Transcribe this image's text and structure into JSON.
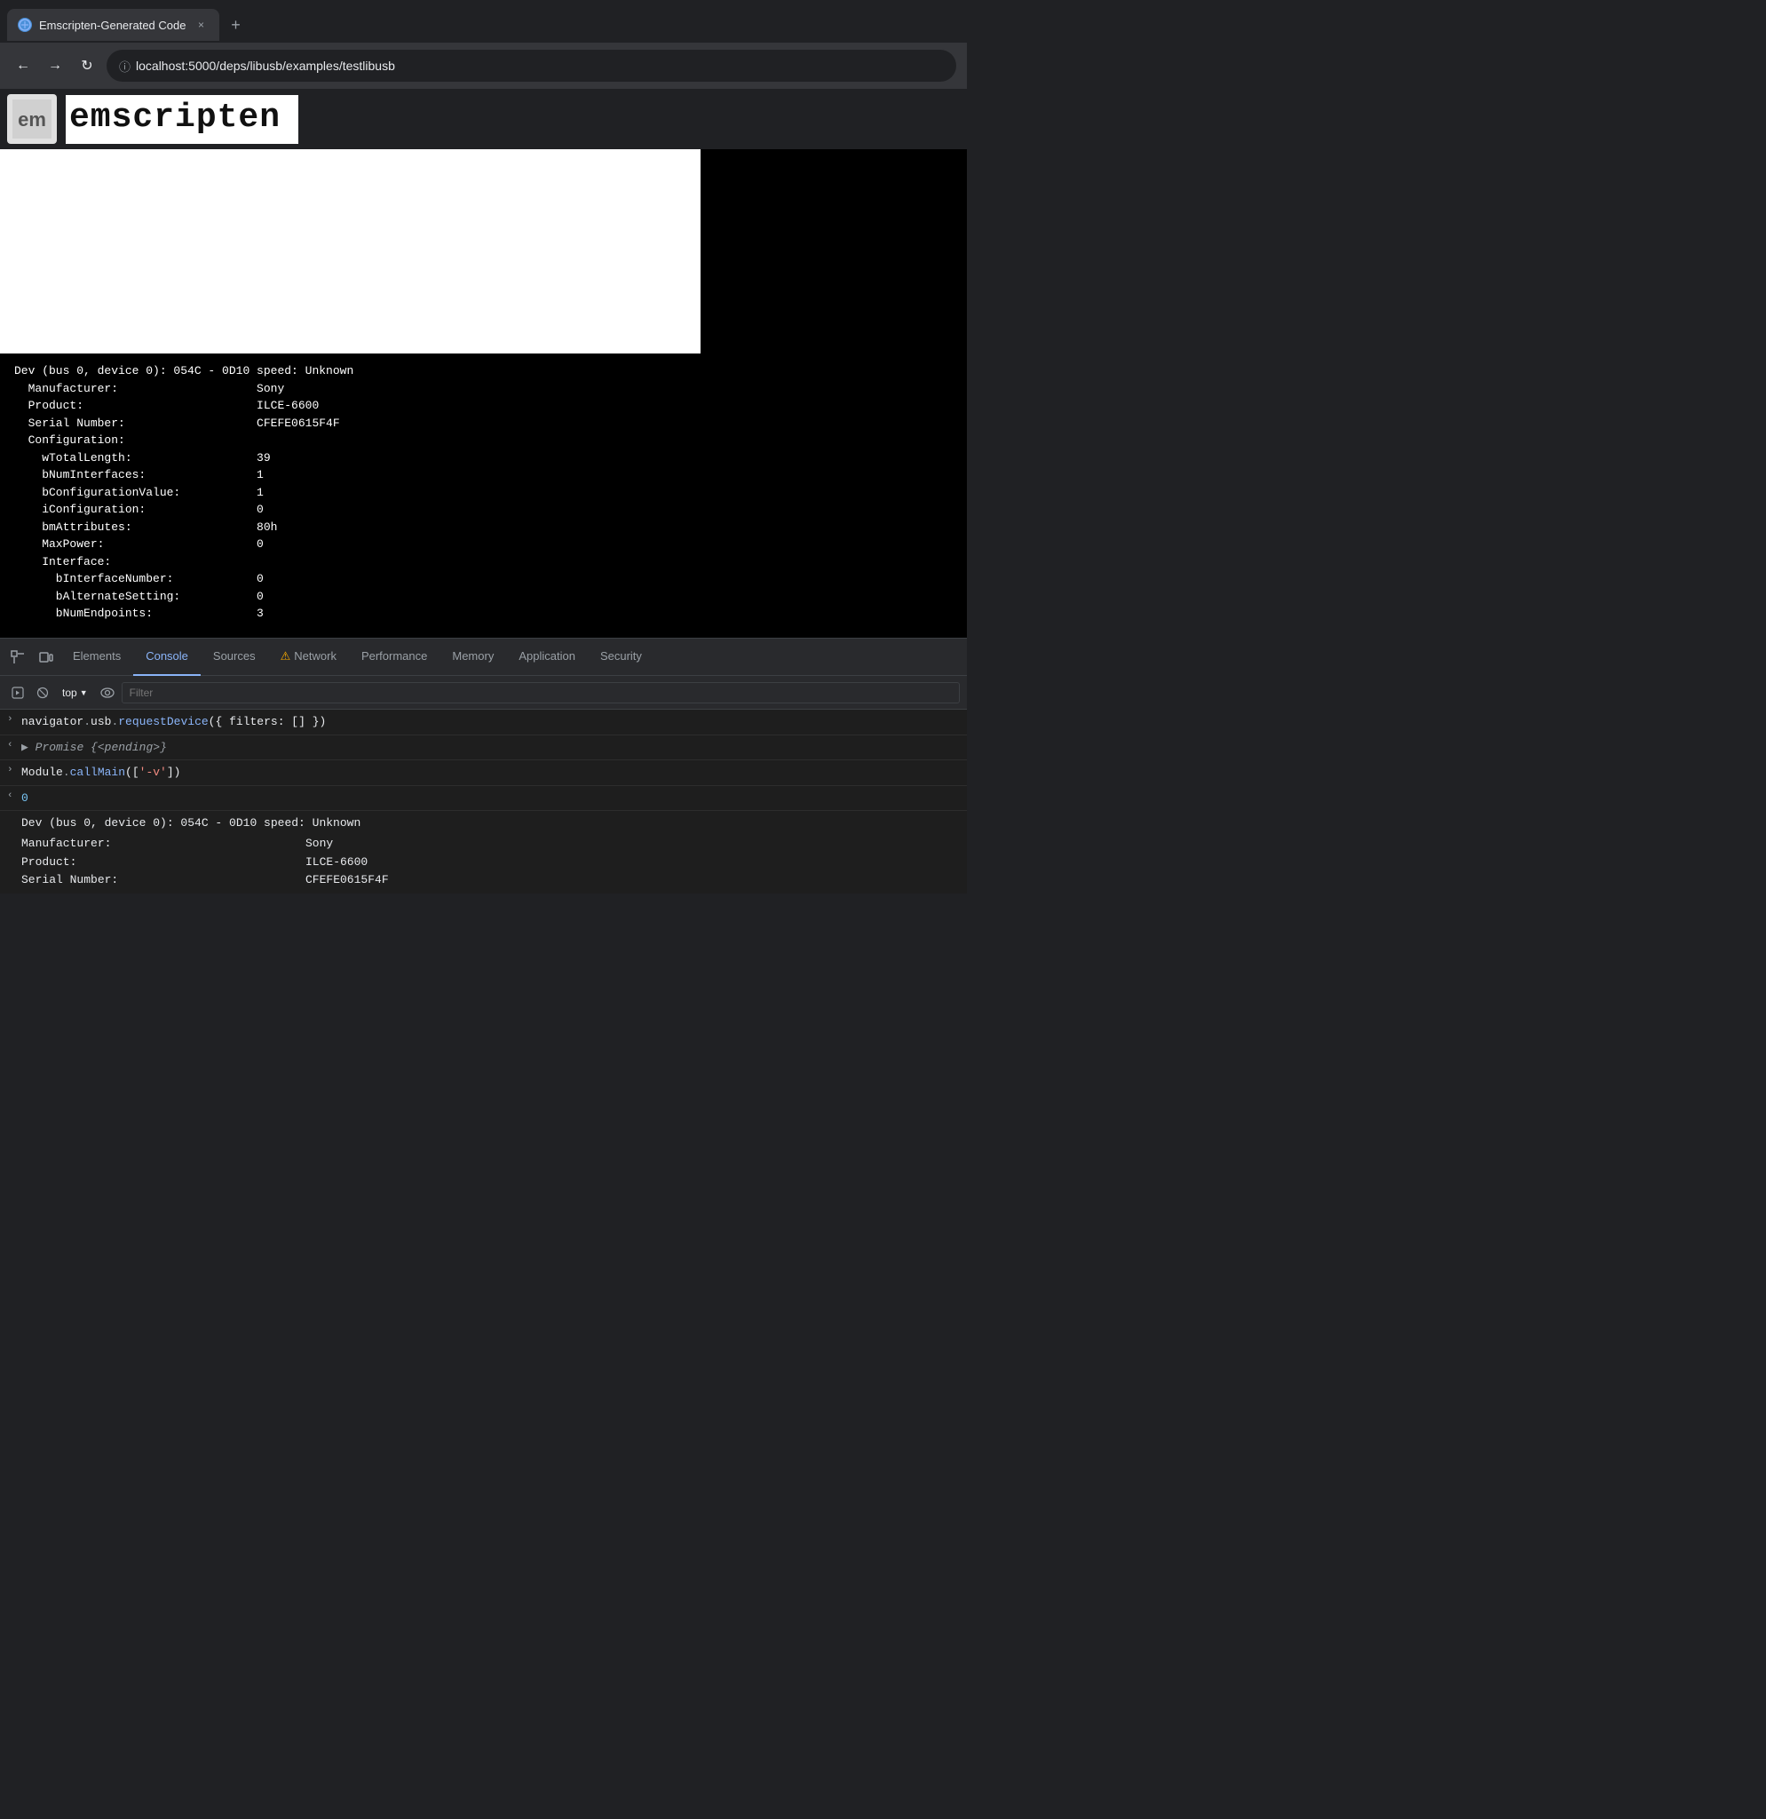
{
  "browser": {
    "tab": {
      "favicon": "🌐",
      "title": "Emscripten-Generated Code",
      "close": "×"
    },
    "new_tab": "+",
    "nav": {
      "back": "←",
      "forward": "→",
      "reload": "↻"
    },
    "url_icon": "ⓘ",
    "url": "localhost:5000/deps/libusb/examples/testlibusb"
  },
  "page": {
    "logo_text": "em",
    "title": "emscripten"
  },
  "terminal": {
    "lines": [
      "Dev (bus 0, device 0): 054C - 0D10 speed: Unknown",
      "  Manufacturer:                    Sony",
      "  Product:                         ILCE-6600",
      "  Serial Number:                   CFEFE0615F4F",
      "  Configuration:",
      "    wTotalLength:                  39",
      "    bNumInterfaces:                1",
      "    bConfigurationValue:           1",
      "    iConfiguration:                0",
      "    bmAttributes:                  80h",
      "    MaxPower:                      0",
      "    Interface:",
      "      bInterfaceNumber:            0",
      "      bAlternateSetting:           0",
      "      bNumEndpoints:               3"
    ]
  },
  "devtools": {
    "tabs": [
      {
        "label": "Elements",
        "active": false
      },
      {
        "label": "Console",
        "active": true
      },
      {
        "label": "Sources",
        "active": false,
        "warn": false
      },
      {
        "label": "Network",
        "active": false,
        "warn": true
      },
      {
        "label": "Performance",
        "active": false
      },
      {
        "label": "Memory",
        "active": false
      },
      {
        "label": "Application",
        "active": false
      },
      {
        "label": "Security",
        "active": false
      }
    ],
    "toolbar": {
      "context": "top",
      "filter_placeholder": "Filter"
    },
    "console": {
      "entries": [
        {
          "type": "input",
          "arrow": ">",
          "code": "navigator.usb.requestDevice({ filters: [] })"
        },
        {
          "type": "output",
          "arrow": "<",
          "code": "▶ Promise {<pending>}",
          "italic": true
        },
        {
          "type": "input",
          "arrow": ">",
          "code": "Module.callMain(['-v'])"
        },
        {
          "type": "output",
          "arrow": "<",
          "code": "0",
          "is_num": true
        }
      ],
      "device_output": {
        "title": "Dev (bus 0, device 0): 054C - 0D10 speed: Unknown",
        "rows": [
          {
            "label": "  Manufacturer:",
            "value": "Sony"
          },
          {
            "label": "  Product:",
            "value": "ILCE-6600"
          },
          {
            "label": "  Serial Number:",
            "value": "CFEFE0615F4F"
          }
        ]
      }
    }
  }
}
